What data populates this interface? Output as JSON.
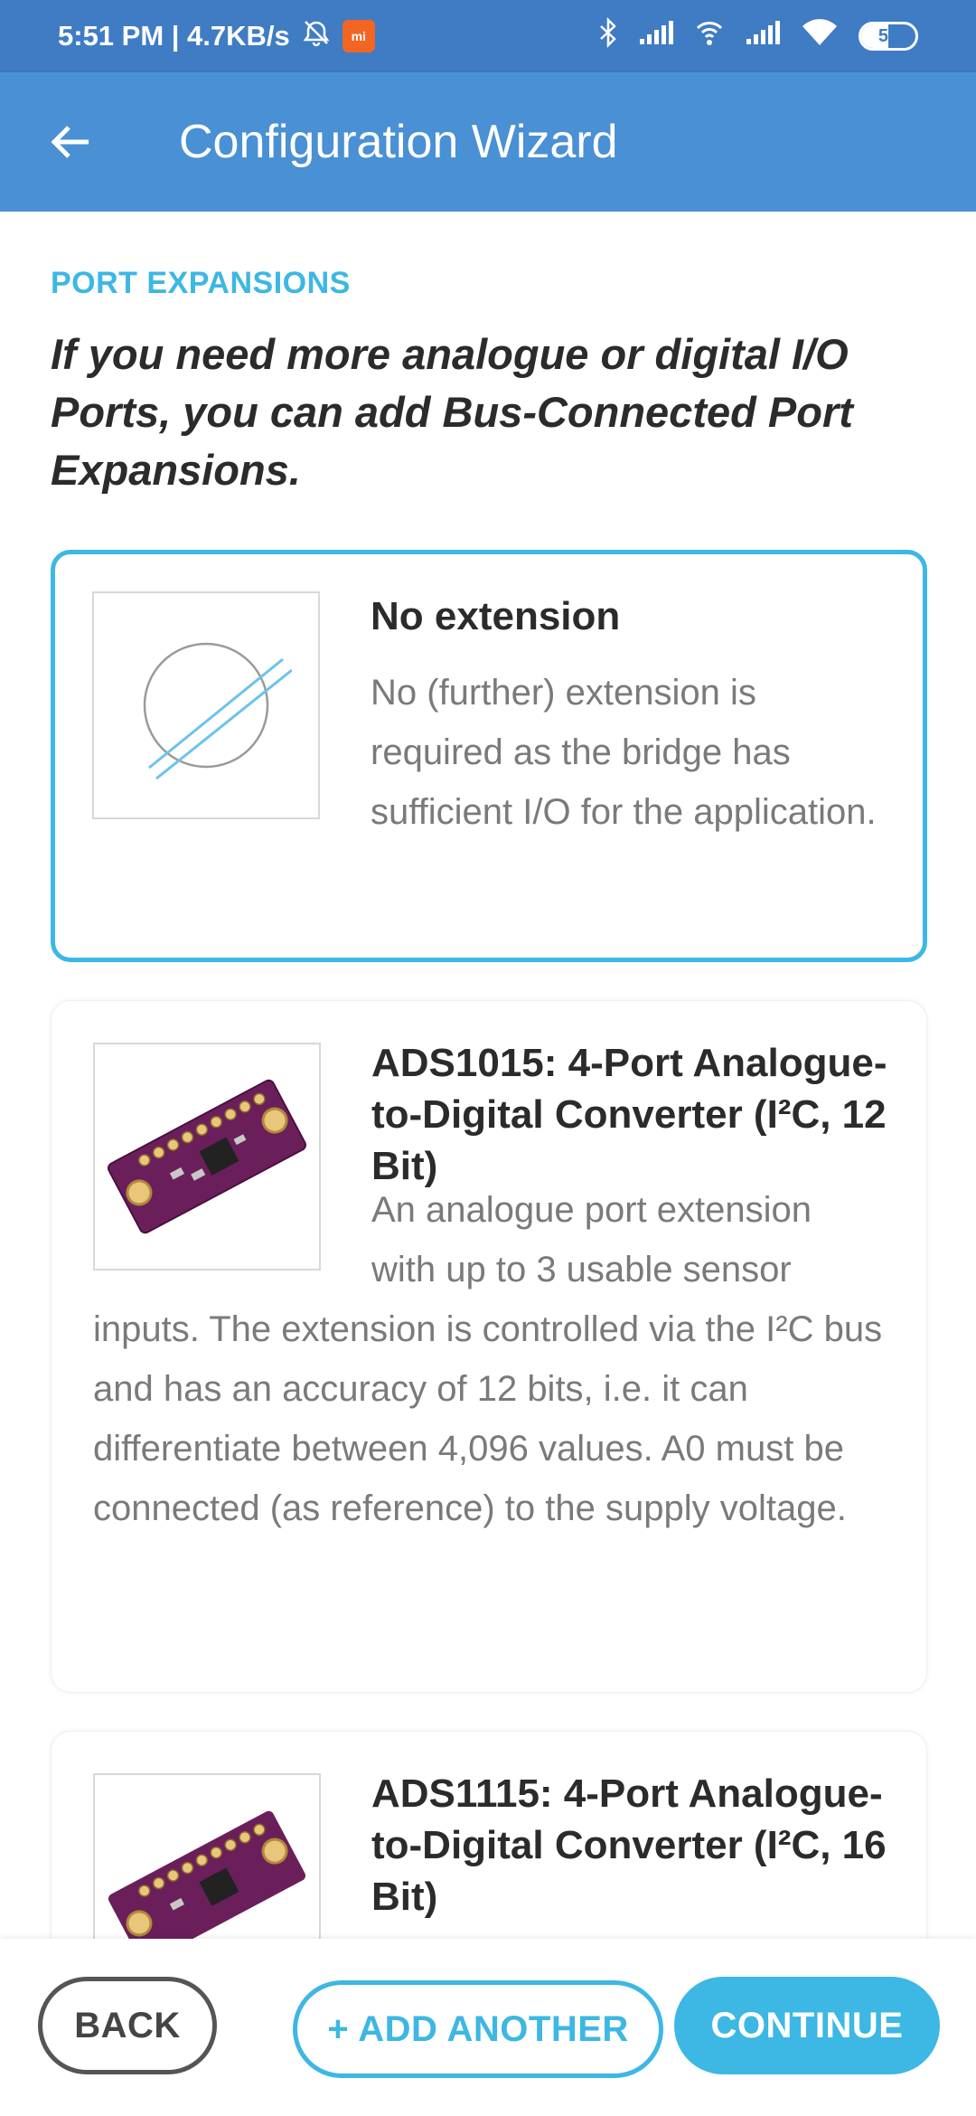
{
  "status_bar": {
    "time_speed": "5:51 PM | 4.7KB/s",
    "battery_level": "50",
    "icons": [
      "alarm-off-icon",
      "mi-app-icon",
      "bluetooth-icon",
      "signal-icon",
      "hotspot-icon",
      "signal-icon",
      "wifi-icon",
      "battery-icon"
    ]
  },
  "app_bar": {
    "title": "Configuration Wizard",
    "back_icon": "back-arrow-icon"
  },
  "section": {
    "label": "PORT EXPANSIONS",
    "heading": "If you need more analogue or digital I/O Ports, you can add Bus-Connected Port Expansions."
  },
  "options": [
    {
      "title": "No extension",
      "description": "No (further) extension is required as the bridge has sufficient I/O for the application.",
      "selected": true,
      "image": "no-extension-icon"
    },
    {
      "title": "ADS1015: 4-Port Analogue-to-Digital Converter (I²C, 12 Bit)",
      "description_wrapped": "An analogue port extension with up to 3 usable sensor",
      "description_full": "inputs. The extension is controlled via the I²C bus and has an accuracy of 12 bits, i.e. it can differentiate between 4,096 values. A0 must be connected (as reference) to the supply voltage.",
      "selected": false,
      "image": "ads1015-board-image"
    },
    {
      "title": "ADS1115: 4-Port Analogue-to-Digital Converter (I²C, 16 Bit)",
      "selected": false,
      "image": "ads1115-board-image"
    }
  ],
  "buttons": {
    "back": "BACK",
    "add_another": "+ ADD ANOTHER",
    "continue": "CONTINUE"
  },
  "colors": {
    "status_bar": "#3f7cc4",
    "app_bar": "#4a90d4",
    "accent": "#3db7e4",
    "board": "#6b1f5a"
  }
}
